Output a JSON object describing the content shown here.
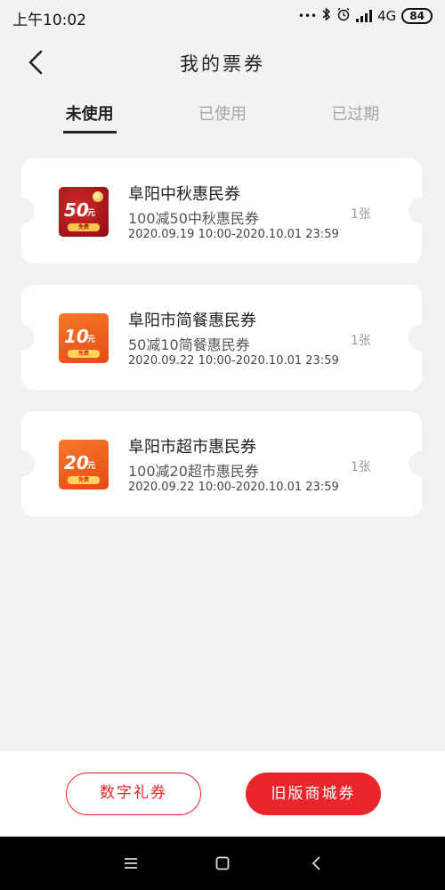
{
  "status_bar": {
    "time": "上午10:02",
    "dots": "•••",
    "network": "4G",
    "battery": "84"
  },
  "header": {
    "title": "我的票券"
  },
  "tabs": [
    {
      "label": "未使用",
      "active": true
    },
    {
      "label": "已使用",
      "active": false
    },
    {
      "label": "已过期",
      "active": false
    }
  ],
  "coupons": [
    {
      "name": "阜阳中秋惠民券",
      "description": "100减50中秋惠民券",
      "validity": "2020.09.19 10:00-2020.10.01 23:59",
      "count": "1张",
      "image": {
        "amount": "50",
        "unit": "元",
        "badge": "免费",
        "bg_color": "#b3141b",
        "badge_color": "#f6c94b"
      }
    },
    {
      "name": "阜阳市简餐惠民券",
      "description": "50减10简餐惠民券",
      "validity": "2020.09.22 10:00-2020.10.01 23:59",
      "count": "1张",
      "image": {
        "amount": "10",
        "unit": "元",
        "badge": "免费",
        "bg_color": "#ec5a1c",
        "badge_color": "#ffd45a"
      }
    },
    {
      "name": "阜阳市超市惠民券",
      "description": "100减20超市惠民券",
      "validity": "2020.09.22 10:00-2020.10.01 23:59",
      "count": "1张",
      "image": {
        "amount": "20",
        "unit": "元",
        "badge": "免费",
        "bg_color": "#ec5a1c",
        "badge_color": "#ffd45a"
      }
    }
  ],
  "bottom_actions": {
    "digital_gift": "数字礼券",
    "old_mall": "旧版商城券"
  },
  "colors": {
    "accent": "#e8262b",
    "background": "#f2f2f2"
  },
  "icons": {
    "back": "chevron-left-icon",
    "bluetooth": "bluetooth-icon",
    "alarm": "alarm-icon",
    "signal": "signal-icon",
    "menu": "menu-icon",
    "home": "home-icon",
    "nav_back": "back-icon"
  }
}
